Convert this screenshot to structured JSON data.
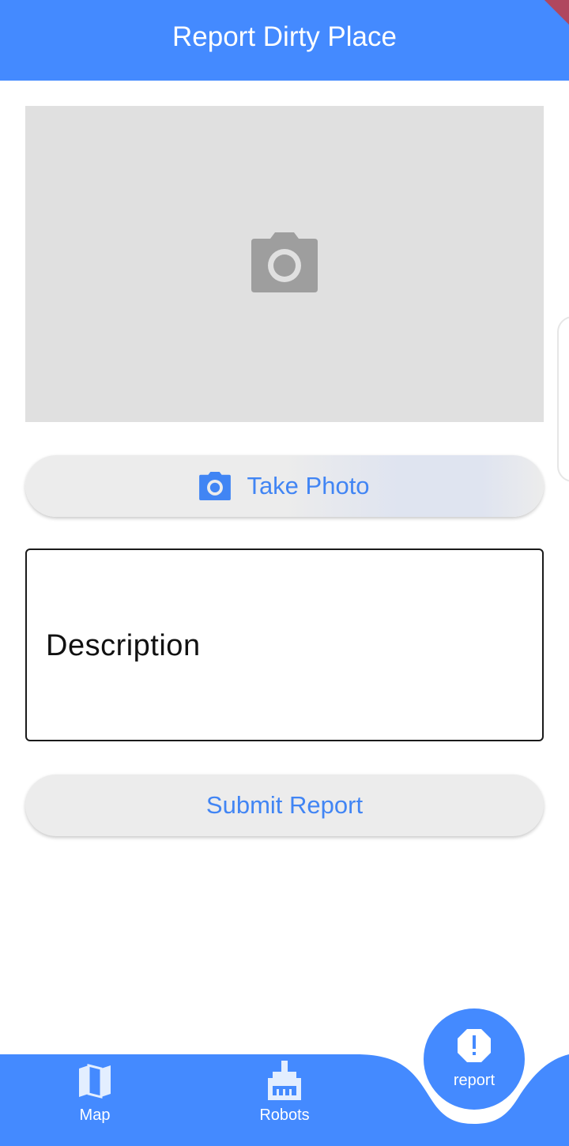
{
  "app_bar": {
    "title": "Report Dirty Place"
  },
  "photo_preview": {
    "icon": "camera-icon"
  },
  "take_photo_button": {
    "label": "Take Photo",
    "icon": "camera-icon"
  },
  "description_field": {
    "label": "Description",
    "value": ""
  },
  "submit_button": {
    "label": "Submit Report"
  },
  "bottom_nav": {
    "items": [
      {
        "label": "Map",
        "icon": "map-icon"
      },
      {
        "label": "Robots",
        "icon": "cleaning-robot-icon"
      }
    ],
    "fab": {
      "label": "report",
      "icon": "report-alert-icon"
    }
  },
  "colors": {
    "primary": "#448AFF",
    "button_text": "#4185F4",
    "button_bg": "#ECECEC",
    "placeholder_bg": "#E0E0E0",
    "placeholder_icon": "#9E9E9E"
  }
}
